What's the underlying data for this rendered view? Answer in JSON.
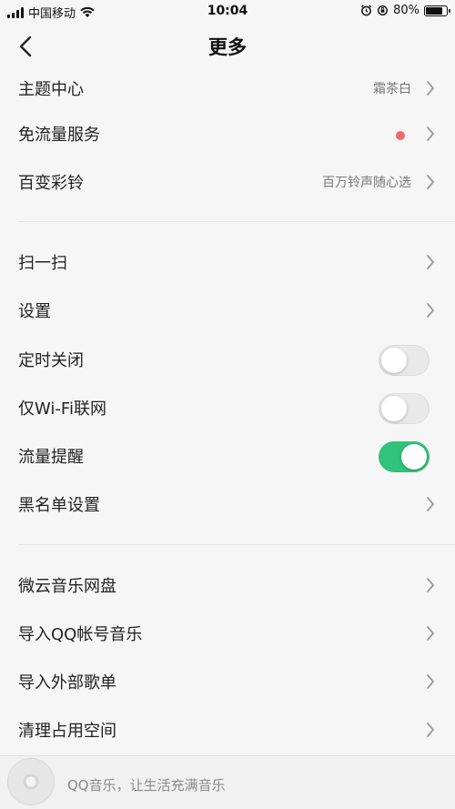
{
  "status_bar": {
    "carrier": "中国移动",
    "time": "10:04",
    "battery": "80%",
    "battery_level": 0.8
  },
  "nav": {
    "title": "更多"
  },
  "rows": {
    "theme": {
      "label": "主题中心",
      "value": "霜茶白"
    },
    "free_data": {
      "label": "免流量服务"
    },
    "ringtone": {
      "label": "百变彩铃",
      "value": "百万铃声随心选"
    },
    "scan": {
      "label": "扫一扫"
    },
    "settings": {
      "label": "设置"
    },
    "sleep_timer": {
      "label": "定时关闭",
      "on": false
    },
    "wifi_only": {
      "label": "仅Wi-Fi联网",
      "on": false
    },
    "data_reminder": {
      "label": "流量提醒",
      "on": true
    },
    "blacklist": {
      "label": "黑名单设置"
    },
    "cloud_disk": {
      "label": "微云音乐网盘"
    },
    "import_qq": {
      "label": "导入QQ帐号音乐"
    },
    "import_external": {
      "label": "导入外部歌单"
    },
    "clear_space": {
      "label": "清理占用空间"
    }
  },
  "player": {
    "text": "QQ音乐，让生活充满音乐"
  },
  "colors": {
    "accent_green": "#31c27c",
    "red_dot": "#ef6a6a"
  }
}
